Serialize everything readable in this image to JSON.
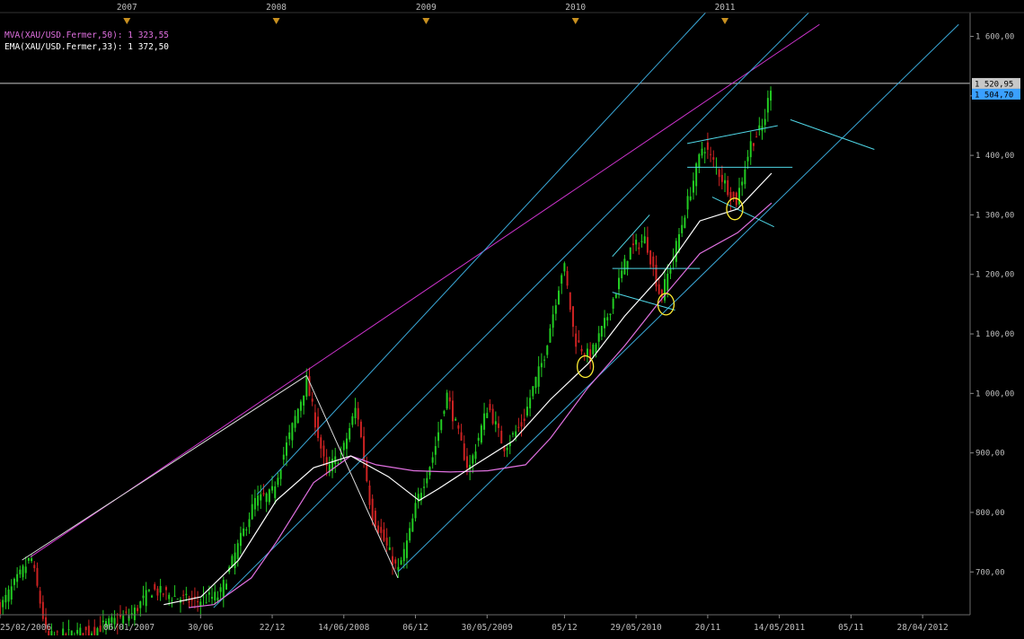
{
  "chart_data": {
    "type": "candlestick",
    "instrument": "XAU/USD",
    "title": "",
    "legend": [
      {
        "label": "MVA(XAU/USD.Fermer,50): 1 323,55",
        "color": "#e070e0"
      },
      {
        "label": "EMA(XAU/USD.Fermer,33): 1 372,50",
        "color": "#ffffff"
      }
    ],
    "price_tags": [
      {
        "value": 1520.95,
        "label": "1 520,95",
        "color": "#c8c8c8"
      },
      {
        "value": 1504.7,
        "label": "1 504,70",
        "color": "#3aa0ff"
      }
    ],
    "y_axis": {
      "ticks": [
        700,
        800,
        900,
        1000,
        1100,
        1200,
        1300,
        1400,
        1500,
        1600
      ],
      "tick_labels": [
        "700,00",
        "800,00",
        "900,00",
        "1 000,00",
        "1 100,00",
        "1 200,00",
        "1 300,00",
        "1 400,00",
        "1 500,00",
        "1 600,00"
      ],
      "ylim": [
        628,
        1640
      ]
    },
    "x_axis": {
      "xlim": [
        "2006-02-25",
        "2012-08-22"
      ],
      "ticks": [
        {
          "date": "2006-02-25",
          "label": "25/02/2006"
        },
        {
          "date": "2007-01-06",
          "label": "06/01/2007"
        },
        {
          "date": "2007-06-30",
          "label": "30/06"
        },
        {
          "date": "2007-12-22",
          "label": "22/12"
        },
        {
          "date": "2008-06-14",
          "label": "14/06/2008"
        },
        {
          "date": "2008-12-06",
          "label": "06/12"
        },
        {
          "date": "2009-05-30",
          "label": "30/05/2009"
        },
        {
          "date": "2009-12-05",
          "label": "05/12"
        },
        {
          "date": "2010-05-29",
          "label": "29/05/2010"
        },
        {
          "date": "2010-11-20",
          "label": "20/11"
        },
        {
          "date": "2011-05-14",
          "label": "14/05/2011"
        },
        {
          "date": "2011-11-05",
          "label": "05/11"
        },
        {
          "date": "2012-04-28",
          "label": "28/04/2012"
        }
      ],
      "year_markers": [
        {
          "date": "2007-01-01",
          "label": "2007"
        },
        {
          "date": "2008-01-01",
          "label": "2008"
        },
        {
          "date": "2009-01-01",
          "label": "2009"
        },
        {
          "date": "2010-01-01",
          "label": "2010"
        },
        {
          "date": "2011-01-01",
          "label": "2011"
        }
      ]
    },
    "price_path": [
      [
        "2006-02-25",
        640
      ],
      [
        "2006-05-12",
        725
      ],
      [
        "2006-06-20",
        590
      ],
      [
        "2006-10-01",
        600
      ],
      [
        "2007-01-15",
        630
      ],
      [
        "2007-03-01",
        670
      ],
      [
        "2007-06-10",
        650
      ],
      [
        "2007-08-15",
        660
      ],
      [
        "2007-11-10",
        820
      ],
      [
        "2007-12-20",
        830
      ],
      [
        "2008-01-20",
        900
      ],
      [
        "2008-03-15",
        1020
      ],
      [
        "2008-05-01",
        870
      ],
      [
        "2008-06-10",
        900
      ],
      [
        "2008-07-15",
        980
      ],
      [
        "2008-08-20",
        800
      ],
      [
        "2008-09-15",
        760
      ],
      [
        "2008-10-24",
        700
      ],
      [
        "2008-11-20",
        760
      ],
      [
        "2008-12-10",
        820
      ],
      [
        "2009-01-20",
        900
      ],
      [
        "2009-02-20",
        1000
      ],
      [
        "2009-04-15",
        870
      ],
      [
        "2009-06-01",
        980
      ],
      [
        "2009-07-10",
        910
      ],
      [
        "2009-08-25",
        950
      ],
      [
        "2009-09-15",
        1000
      ],
      [
        "2009-10-15",
        1060
      ],
      [
        "2009-12-03",
        1220
      ],
      [
        "2009-12-30",
        1090
      ],
      [
        "2010-02-05",
        1060
      ],
      [
        "2010-03-15",
        1120
      ],
      [
        "2010-05-12",
        1240
      ],
      [
        "2010-06-21",
        1260
      ],
      [
        "2010-07-28",
        1160
      ],
      [
        "2010-09-01",
        1240
      ],
      [
        "2010-10-01",
        1320
      ],
      [
        "2010-11-09",
        1420
      ],
      [
        "2010-12-10",
        1380
      ],
      [
        "2011-01-28",
        1320
      ],
      [
        "2011-03-05",
        1420
      ],
      [
        "2011-04-05",
        1450
      ],
      [
        "2011-04-29",
        1540
      ]
    ],
    "series": [
      {
        "name": "MVA(XAU/USD.Fermer,50)",
        "color": "#e070e0",
        "points": [
          [
            "2007-06-01",
            640
          ],
          [
            "2007-08-01",
            645
          ],
          [
            "2007-11-01",
            690
          ],
          [
            "2008-01-01",
            750
          ],
          [
            "2008-04-01",
            850
          ],
          [
            "2008-07-01",
            895
          ],
          [
            "2008-09-01",
            880
          ],
          [
            "2008-12-01",
            870
          ],
          [
            "2009-03-01",
            868
          ],
          [
            "2009-06-01",
            870
          ],
          [
            "2009-09-01",
            880
          ],
          [
            "2009-11-01",
            925
          ],
          [
            "2010-02-01",
            1010
          ],
          [
            "2010-05-01",
            1080
          ],
          [
            "2010-08-01",
            1160
          ],
          [
            "2010-11-01",
            1235
          ],
          [
            "2011-02-01",
            1270
          ],
          [
            "2011-04-25",
            1320
          ]
        ]
      },
      {
        "name": "EMA(XAU/USD.Fermer,33)",
        "color": "#ffffff",
        "points": [
          [
            "2007-04-01",
            645
          ],
          [
            "2007-07-01",
            658
          ],
          [
            "2007-10-01",
            720
          ],
          [
            "2008-01-01",
            820
          ],
          [
            "2008-04-01",
            875
          ],
          [
            "2008-07-01",
            895
          ],
          [
            "2008-10-01",
            860
          ],
          [
            "2008-12-15",
            820
          ],
          [
            "2009-02-01",
            840
          ],
          [
            "2009-05-01",
            880
          ],
          [
            "2009-08-01",
            920
          ],
          [
            "2009-11-01",
            990
          ],
          [
            "2010-02-01",
            1050
          ],
          [
            "2010-05-01",
            1130
          ],
          [
            "2010-08-01",
            1200
          ],
          [
            "2010-11-01",
            1290
          ],
          [
            "2011-02-01",
            1310
          ],
          [
            "2011-04-25",
            1370
          ]
        ]
      }
    ],
    "lines": [
      {
        "kind": "horizontal",
        "value": 1520.95,
        "color": "#c8c8c8"
      },
      {
        "kind": "trend",
        "color": "#cc33cc",
        "points": [
          [
            "2006-05-10",
            725
          ],
          [
            "2011-08-20",
            1620
          ]
        ]
      },
      {
        "kind": "trend",
        "color": "#3aa8d8",
        "points": [
          [
            "2007-11-15",
            830
          ],
          [
            "2010-11-15",
            1640
          ]
        ]
      },
      {
        "kind": "trend",
        "color": "#3aa8d8",
        "points": [
          [
            "2007-08-01",
            640
          ],
          [
            "2011-07-25",
            1640
          ]
        ]
      },
      {
        "kind": "trend",
        "color": "#3aa8d8",
        "points": [
          [
            "2008-10-24",
            700
          ],
          [
            "2012-07-25",
            1620
          ]
        ]
      },
      {
        "kind": "trend",
        "color": "#dddddd",
        "points": [
          [
            "2008-03-15",
            1030
          ],
          [
            "2008-10-24",
            690
          ]
        ]
      },
      {
        "kind": "trend",
        "color": "#dddddd",
        "points": [
          [
            "2008-03-15",
            1030
          ],
          [
            "2006-04-20",
            720
          ]
        ]
      },
      {
        "kind": "trend",
        "color": "#4fd6e6",
        "points": [
          [
            "2010-04-01",
            1230
          ],
          [
            "2010-07-01",
            1300
          ]
        ]
      },
      {
        "kind": "trend",
        "color": "#4fd6e6",
        "points": [
          [
            "2010-04-01",
            1210
          ],
          [
            "2010-11-01",
            1210
          ]
        ]
      },
      {
        "kind": "trend",
        "color": "#4fd6e6",
        "points": [
          [
            "2010-04-01",
            1170
          ],
          [
            "2010-09-01",
            1140
          ]
        ]
      },
      {
        "kind": "trend",
        "color": "#4fd6e6",
        "points": [
          [
            "2010-10-01",
            1420
          ],
          [
            "2011-05-10",
            1450
          ]
        ]
      },
      {
        "kind": "trend",
        "color": "#4fd6e6",
        "points": [
          [
            "2010-10-01",
            1380
          ],
          [
            "2011-06-15",
            1380
          ]
        ]
      },
      {
        "kind": "trend",
        "color": "#4fd6e6",
        "points": [
          [
            "2010-12-01",
            1330
          ],
          [
            "2011-05-01",
            1280
          ]
        ]
      },
      {
        "kind": "trend",
        "color": "#4fd6e6",
        "points": [
          [
            "2011-06-10",
            1460
          ],
          [
            "2012-01-01",
            1410
          ]
        ]
      }
    ],
    "ellipses": [
      {
        "date": "2010-01-25",
        "value": 1045,
        "color": "#ffee33"
      },
      {
        "date": "2010-08-10",
        "value": 1150,
        "color": "#ffee33"
      },
      {
        "date": "2011-01-25",
        "value": 1310,
        "color": "#ffee33"
      }
    ],
    "candle_colors": {
      "up": "#22cc22",
      "down": "#cc2222"
    },
    "grid": false
  }
}
